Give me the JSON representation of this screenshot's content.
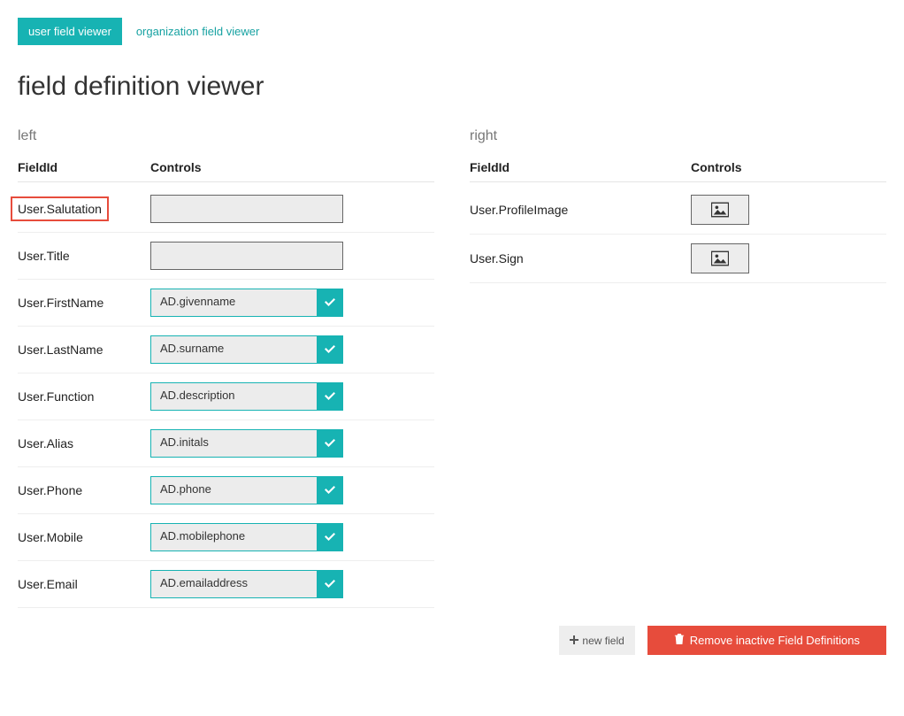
{
  "tabs": {
    "user": "user field viewer",
    "organization": "organization field viewer"
  },
  "page_title": "field definition viewer",
  "columns": {
    "left": {
      "heading": "left",
      "header_fieldid": "FieldId",
      "header_controls": "Controls",
      "rows": [
        {
          "fieldId": "User.Salutation",
          "control": "",
          "type": "text",
          "highlighted": true
        },
        {
          "fieldId": "User.Title",
          "control": "",
          "type": "text"
        },
        {
          "fieldId": "User.FirstName",
          "control": "AD.givenname",
          "type": "text-check"
        },
        {
          "fieldId": "User.LastName",
          "control": "AD.surname",
          "type": "text-check"
        },
        {
          "fieldId": "User.Function",
          "control": "AD.description",
          "type": "text-check"
        },
        {
          "fieldId": "User.Alias",
          "control": "AD.initals",
          "type": "text-check"
        },
        {
          "fieldId": "User.Phone",
          "control": "AD.phone",
          "type": "text-check"
        },
        {
          "fieldId": "User.Mobile",
          "control": "AD.mobilephone",
          "type": "text-check"
        },
        {
          "fieldId": "User.Email",
          "control": "AD.emailaddress",
          "type": "text-check"
        }
      ]
    },
    "right": {
      "heading": "right",
      "header_fieldid": "FieldId",
      "header_controls": "Controls",
      "rows": [
        {
          "fieldId": "User.ProfileImage",
          "type": "image"
        },
        {
          "fieldId": "User.Sign",
          "type": "image"
        }
      ]
    }
  },
  "footer": {
    "new_field": "new field",
    "remove_inactive": "Remove inactive Field Definitions"
  }
}
